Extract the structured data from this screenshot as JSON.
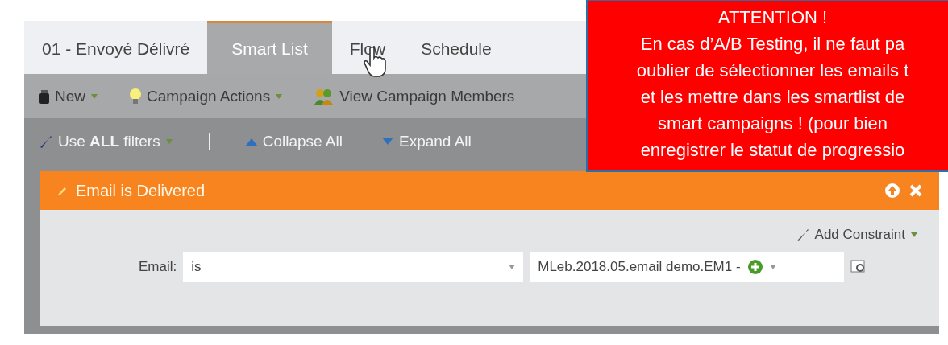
{
  "tabs": [
    {
      "label": "01 - Envoyé Délivré",
      "selected": false
    },
    {
      "label": "Smart List",
      "selected": true
    },
    {
      "label": "Flow",
      "selected": false
    },
    {
      "label": "Schedule",
      "selected": false
    }
  ],
  "toolbar": [
    {
      "label": "New",
      "kind": "new",
      "dropdown": true
    },
    {
      "label": "Campaign Actions",
      "kind": "bulb",
      "dropdown": true
    },
    {
      "label": "View Campaign Members",
      "kind": "people",
      "dropdown": false
    }
  ],
  "filter_bar": {
    "rule_menu": "Use **ALL** filters",
    "collapse": "Collapse All",
    "expand": "Expand All"
  },
  "filter": {
    "title": "Email is Delivered",
    "add_constraint": "Add Constraint",
    "field_label": "Email:",
    "operator": "is",
    "value": "MLeb.2018.05.email demo.EM1 -"
  },
  "notice": {
    "title": "ATTENTION !",
    "lines": [
      "En cas d’A/B Testing, il ne faut pa",
      "oublier de sélectionner les emails t",
      "et les mettre dans les smartlist de",
      "smart campaigns ! (pour bien",
      "enregistrer le statut de progressio"
    ]
  }
}
